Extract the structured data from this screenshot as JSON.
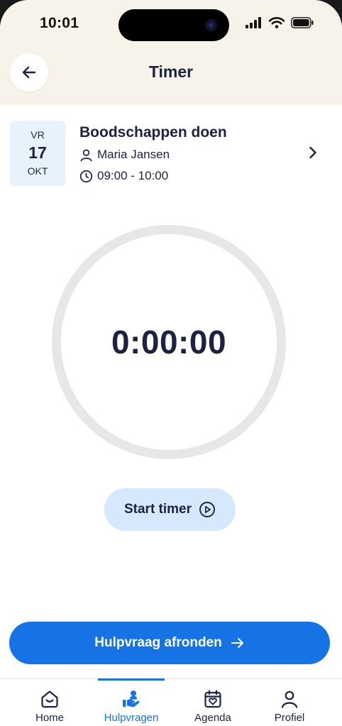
{
  "status_bar": {
    "time": "10:01"
  },
  "header": {
    "title": "Timer"
  },
  "event": {
    "date": {
      "day_of_week": "VR",
      "day": "17",
      "month": "OKT"
    },
    "title": "Boodschappen doen",
    "person": "Maria Jansen",
    "time_range": "09:00 - 10:00"
  },
  "timer": {
    "value": "0:00:00"
  },
  "actions": {
    "start_label": "Start timer",
    "complete_label": "Hulpvraag afronden"
  },
  "tabbar": {
    "active": "Hulpvragen",
    "items": [
      {
        "label": "Home",
        "icon": "home-icon"
      },
      {
        "label": "Hulpvragen",
        "icon": "help-hand-icon"
      },
      {
        "label": "Agenda",
        "icon": "calendar-heart-icon"
      },
      {
        "label": "Profiel",
        "icon": "profile-icon"
      }
    ]
  },
  "colors": {
    "accent": "#1673e6",
    "header_bg": "#f7f3ea",
    "text": "#1c2340",
    "date_tile_bg": "#e8f2fd",
    "secondary_button_bg": "#d6e8fb"
  }
}
